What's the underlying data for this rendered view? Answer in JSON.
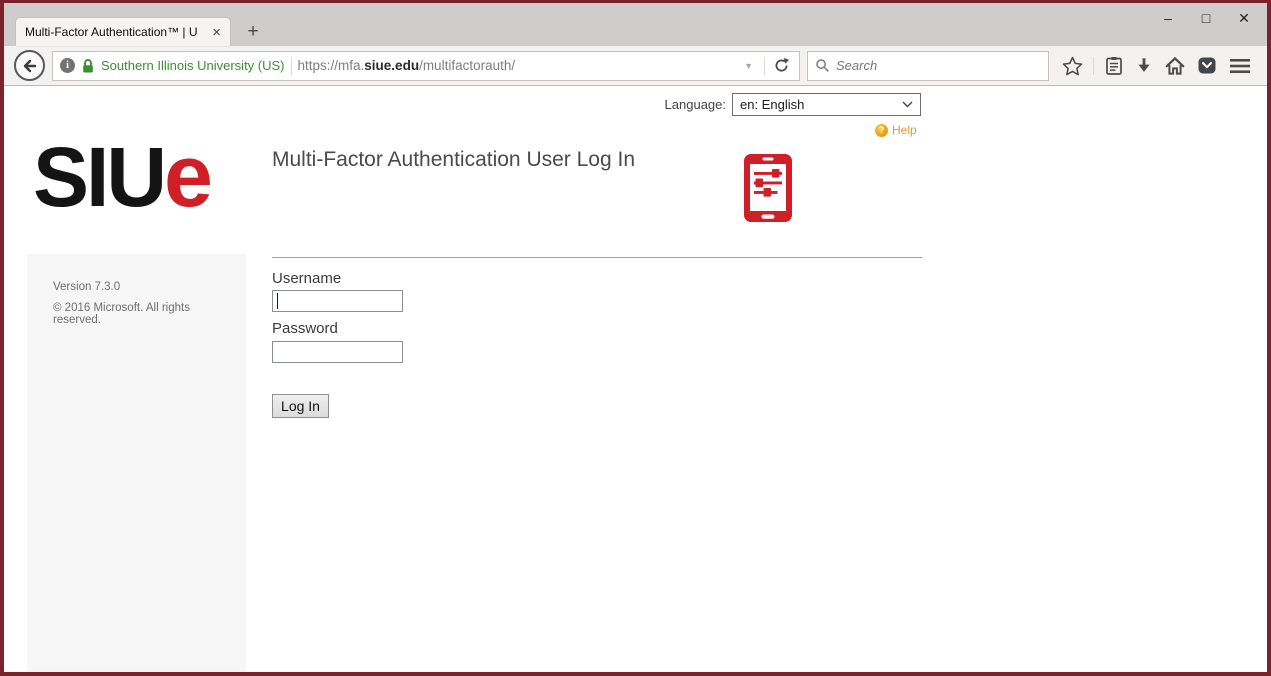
{
  "colors": {
    "window_border": "#7b222c",
    "brand_red": "#d11f27",
    "help_orange": "#e0993c",
    "ev_green": "#3c8f2f"
  },
  "titlebar": {
    "tab_title": "Multi-Factor Authentication™ | U",
    "tab_close_icon": "×",
    "new_tab_icon": "+",
    "window_controls": {
      "minimize": "–",
      "maximize": "□",
      "close": "✕"
    }
  },
  "navbar": {
    "identity_text": "Southern Illinois University (US)",
    "url": {
      "prefix": "https://mfa.",
      "domain": "siue.edu",
      "path": "/multifactorauth/"
    },
    "url_dropdown_icon": "▼",
    "search_placeholder": "Search"
  },
  "page": {
    "language_label": "Language:",
    "language_selected": "en: English",
    "help_label": "Help",
    "help_icon_glyph": "?",
    "logo": {
      "black": "SIU",
      "red": "e"
    },
    "title": "Multi-Factor Authentication User Log In",
    "sidebar": {
      "version": "Version 7.3.0",
      "copyright": "© 2016 Microsoft. All rights reserved."
    },
    "form": {
      "username_label": "Username",
      "password_label": "Password",
      "username_value": "",
      "password_value": "",
      "login_button": "Log In"
    }
  }
}
